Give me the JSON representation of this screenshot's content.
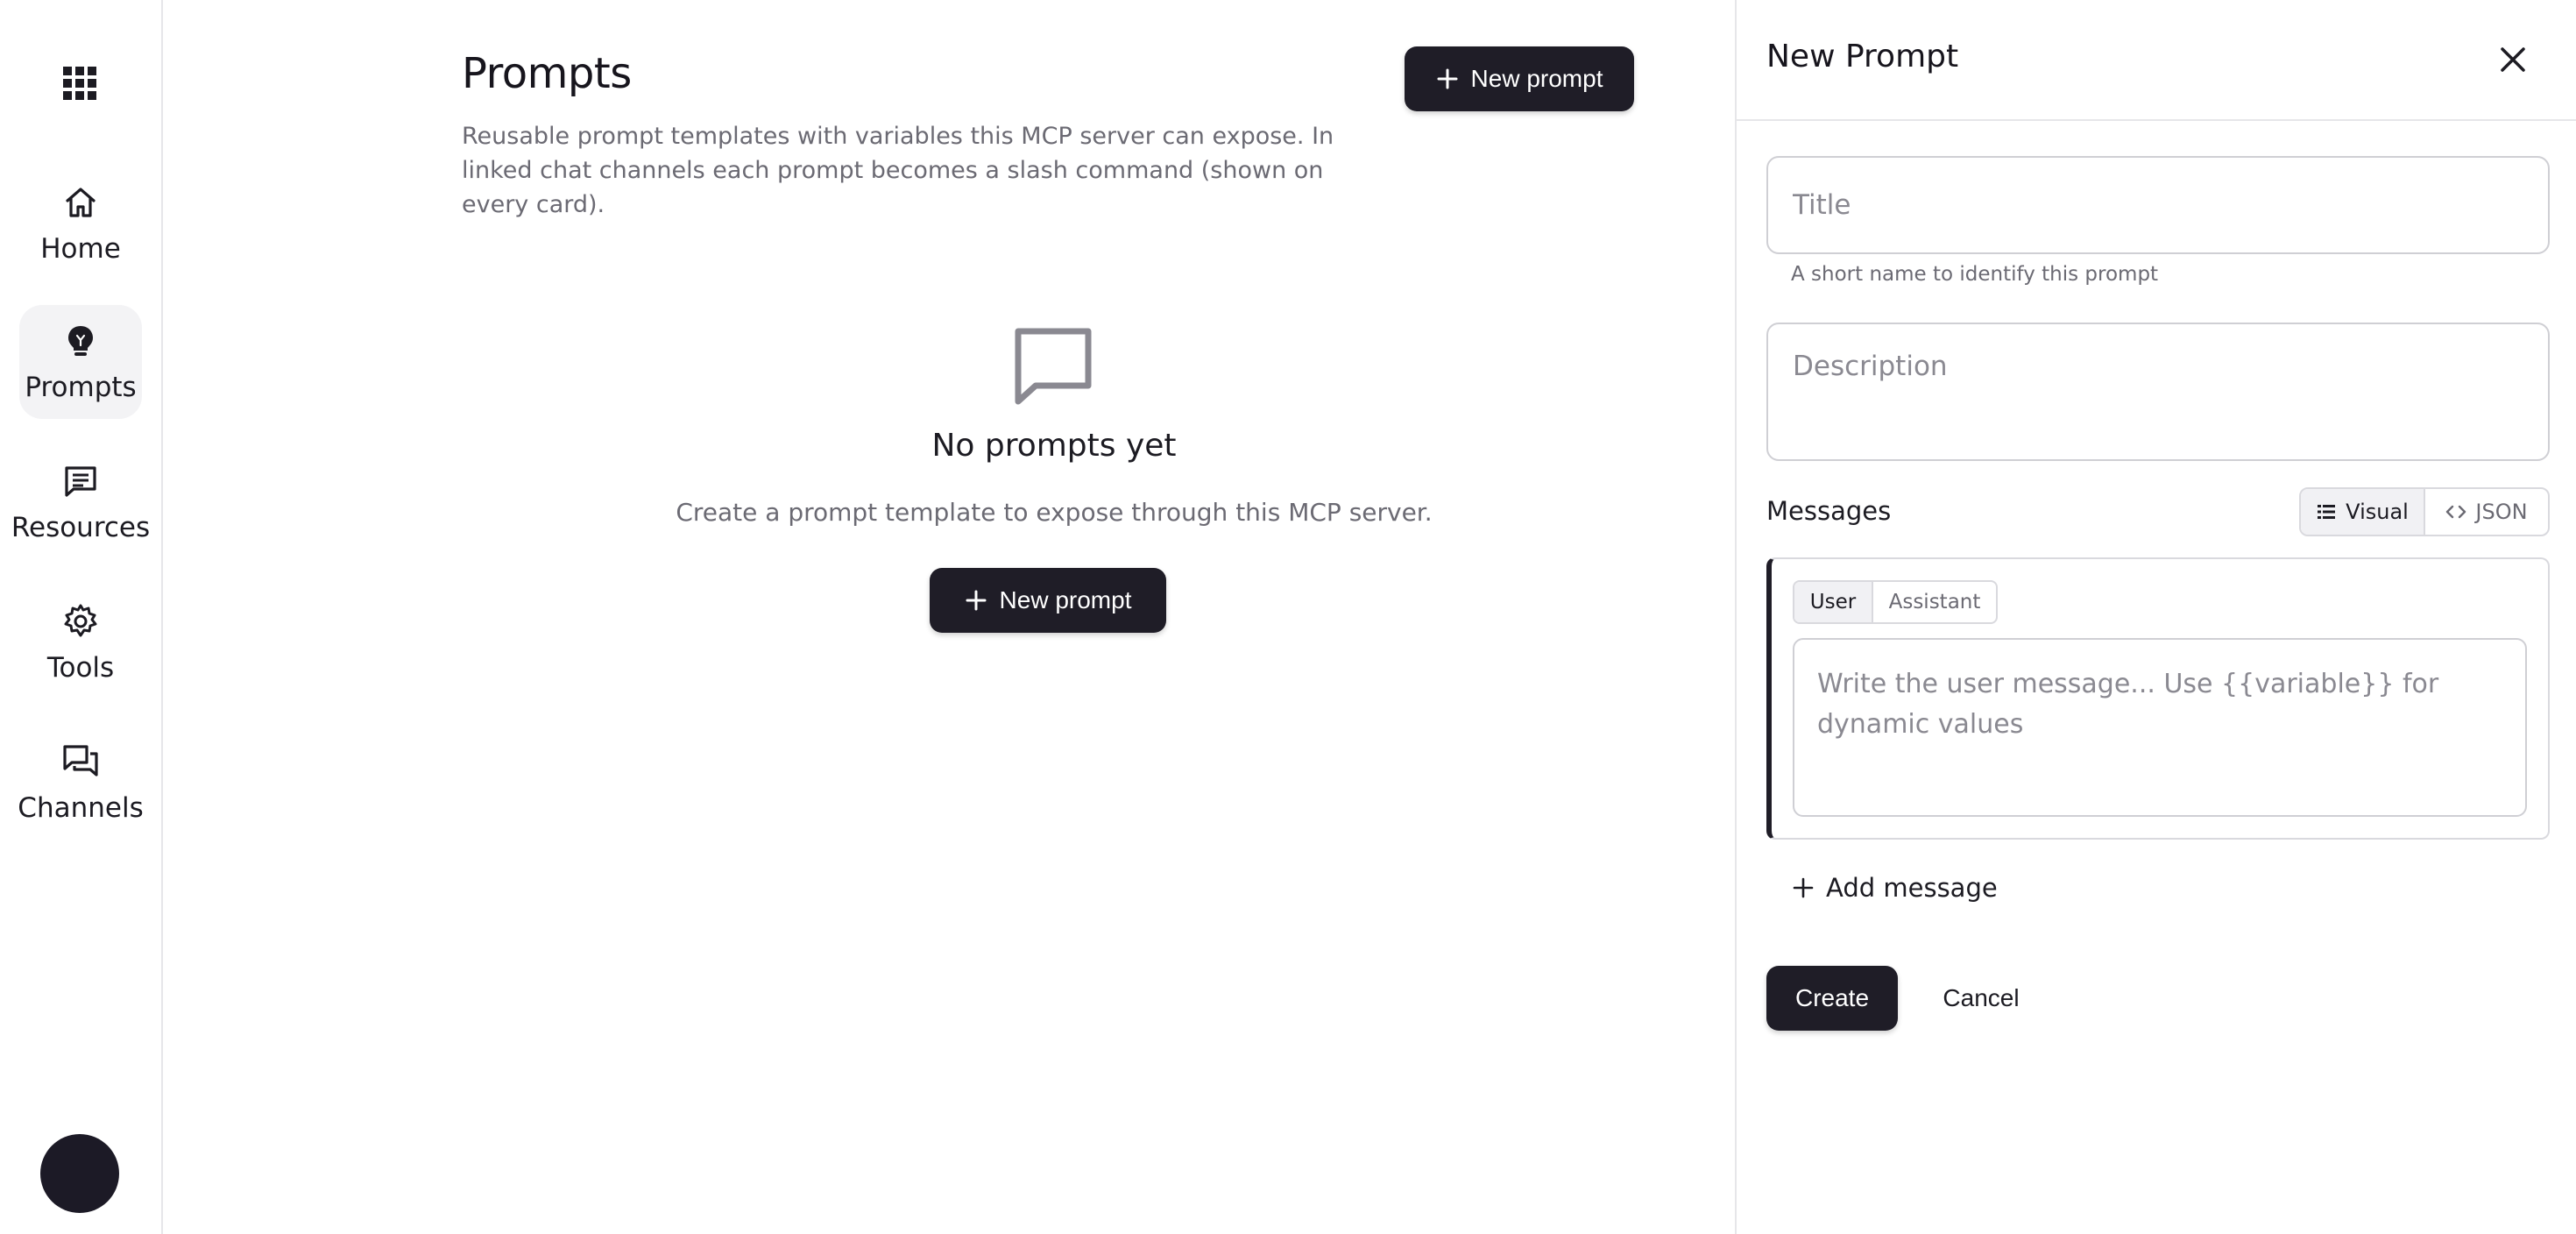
{
  "sidebar": {
    "items": [
      {
        "label": "Home",
        "icon": "home-icon"
      },
      {
        "label": "Prompts",
        "icon": "lightbulb-icon",
        "active": true
      },
      {
        "label": "Resources",
        "icon": "message-square-icon"
      },
      {
        "label": "Tools",
        "icon": "gear-icon"
      },
      {
        "label": "Channels",
        "icon": "chat-bubbles-icon"
      }
    ]
  },
  "main": {
    "title": "Prompts",
    "description": "Reusable prompt templates with variables this MCP server can expose. In linked chat channels each prompt becomes a slash command (shown on every card).",
    "new_prompt_label": "New prompt",
    "empty": {
      "title": "No prompts yet",
      "description": "Create a prompt template to expose through this MCP server.",
      "button_label": "New prompt"
    }
  },
  "panel": {
    "title": "New Prompt",
    "title_field": {
      "value": "",
      "placeholder": "Title",
      "helper": "A short name to identify this prompt"
    },
    "description_field": {
      "value": "",
      "placeholder": "Description"
    },
    "messages_label": "Messages",
    "view_toggle": [
      {
        "label": "Visual",
        "selected": true
      },
      {
        "label": "JSON",
        "selected": false
      }
    ],
    "message": {
      "roles": [
        {
          "label": "User",
          "selected": true
        },
        {
          "label": "Assistant",
          "selected": false
        }
      ],
      "value": "",
      "placeholder": "Write the user message... Use {{variable}} for dynamic values"
    },
    "add_message_label": "Add message",
    "create_label": "Create",
    "cancel_label": "Cancel"
  },
  "colors": {
    "primary_button": "#1f1d27",
    "active_nav_bg": "#f3f3f5",
    "muted_text": "#6b6a73",
    "border": "#d9d9de"
  }
}
